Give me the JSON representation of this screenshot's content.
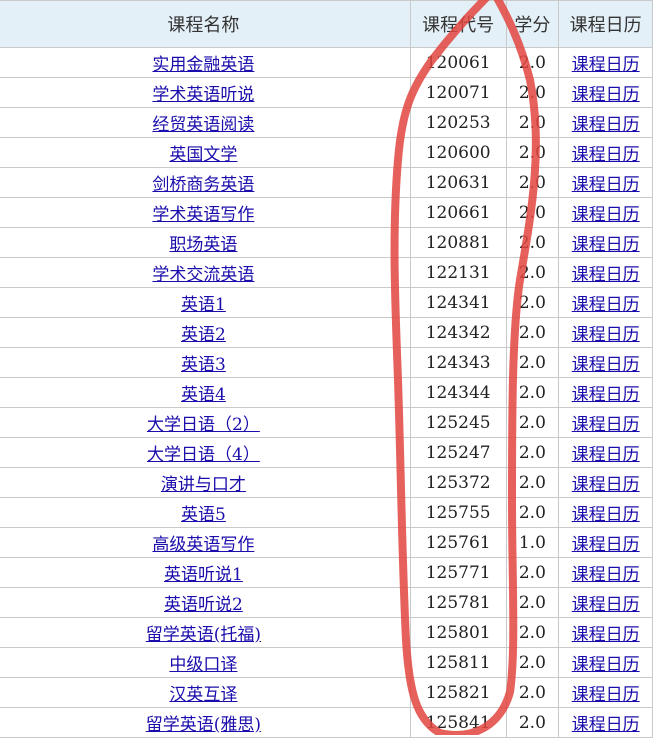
{
  "columns": {
    "name": "课程名称",
    "code": "课程代号",
    "credit": "学分",
    "calendar": "课程日历"
  },
  "calendar_link_label": "课程日历",
  "courses": [
    {
      "name": "实用金融英语",
      "code": "120061",
      "credit": "2.0"
    },
    {
      "name": "学术英语听说",
      "code": "120071",
      "credit": "2.0"
    },
    {
      "name": "经贸英语阅读",
      "code": "120253",
      "credit": "2.0"
    },
    {
      "name": "英国文学",
      "code": "120600",
      "credit": "2.0"
    },
    {
      "name": "剑桥商务英语",
      "code": "120631",
      "credit": "2.0"
    },
    {
      "name": "学术英语写作",
      "code": "120661",
      "credit": "2.0"
    },
    {
      "name": "职场英语",
      "code": "120881",
      "credit": "2.0"
    },
    {
      "name": "学术交流英语",
      "code": "122131",
      "credit": "2.0"
    },
    {
      "name": "英语1",
      "code": "124341",
      "credit": "2.0"
    },
    {
      "name": "英语2",
      "code": "124342",
      "credit": "2.0"
    },
    {
      "name": "英语3",
      "code": "124343",
      "credit": "2.0"
    },
    {
      "name": "英语4",
      "code": "124344",
      "credit": "2.0"
    },
    {
      "name": "大学日语（2）",
      "code": "125245",
      "credit": "2.0"
    },
    {
      "name": "大学日语（4）",
      "code": "125247",
      "credit": "2.0"
    },
    {
      "name": "演讲与口才",
      "code": "125372",
      "credit": "2.0"
    },
    {
      "name": "英语5",
      "code": "125755",
      "credit": "2.0"
    },
    {
      "name": "高级英语写作",
      "code": "125761",
      "credit": "1.0"
    },
    {
      "name": "英语听说1",
      "code": "125771",
      "credit": "2.0"
    },
    {
      "name": "英语听说2",
      "code": "125781",
      "credit": "2.0"
    },
    {
      "name": "留学英语(托福)",
      "code": "125801",
      "credit": "2.0"
    },
    {
      "name": "中级口译",
      "code": "125811",
      "credit": "2.0"
    },
    {
      "name": "汉英互译",
      "code": "125821",
      "credit": "2.0"
    },
    {
      "name": "留学英语(雅思)",
      "code": "125841",
      "credit": "2.0"
    }
  ],
  "colors": {
    "header_bg": "#e4f0f8",
    "link": "#1a0dab",
    "grid": "#c9c9c9",
    "annotation_stroke": "#e2453f"
  }
}
